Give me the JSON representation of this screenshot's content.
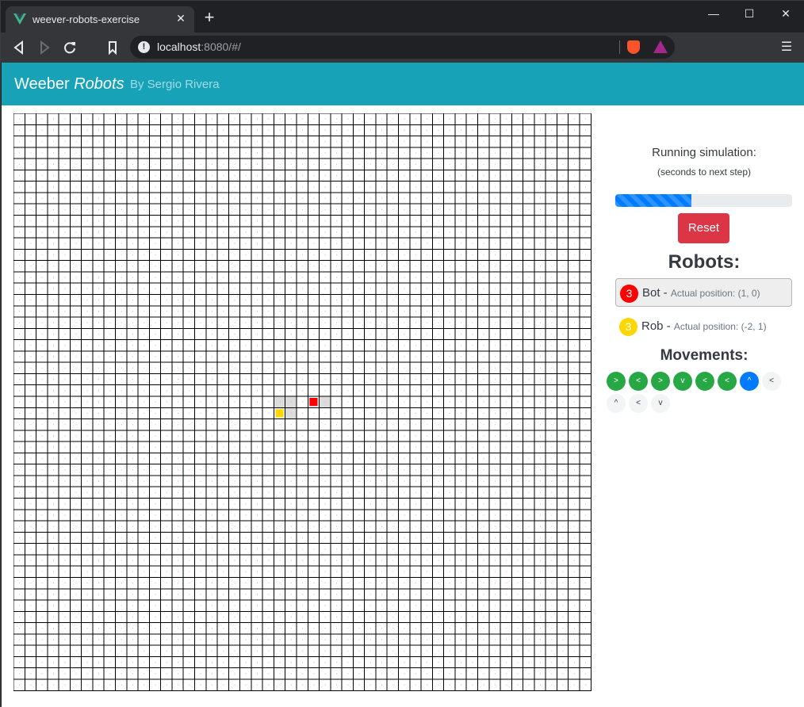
{
  "browser": {
    "tab_title": "weever-robots-exercise",
    "new_tab": "+",
    "minimize": "—",
    "maximize": "☐",
    "close": "✕",
    "url_host": "localhost",
    "url_rest": ":8080/#/",
    "icons": [
      "vue-logo-icon",
      "back-icon",
      "forward-icon",
      "reload-icon",
      "bookmark-icon",
      "info-icon",
      "brave-shield-icon",
      "bat-icon",
      "menu-icon"
    ]
  },
  "header": {
    "brand_main": "Weeber",
    "brand_italic": "Robots",
    "author": "By Sergio Rivera",
    "color": "#17a2b8"
  },
  "grid": {
    "cols": 51,
    "rows": 51,
    "robots_on_grid": [
      {
        "name": "Bot",
        "col": 26,
        "row": 25,
        "color": "#ff0000"
      },
      {
        "name": "Rob",
        "col": 23,
        "row": 26,
        "color": "#ffd700"
      }
    ],
    "highlighted_cells": [
      {
        "col": 23,
        "row": 25
      },
      {
        "col": 24,
        "row": 25
      },
      {
        "col": 24,
        "row": 26
      },
      {
        "col": 27,
        "row": 25
      }
    ]
  },
  "simulation": {
    "title": "Running simulation:",
    "subtitle": "(seconds to next step)",
    "progress": 0.43,
    "reset_label": "Reset"
  },
  "robots": {
    "title": "Robots:",
    "list": [
      {
        "badge": "3",
        "name": "Bot -",
        "position": "Actual position: (1, 0)",
        "color": "#ff0000",
        "active": true
      },
      {
        "badge": "3",
        "name": "Rob -",
        "position": "Actual position: (-2, 1)",
        "color": "#ffd700",
        "active": false
      }
    ]
  },
  "movements": {
    "title": "Movements:",
    "list": [
      {
        "label": ">",
        "state": "done"
      },
      {
        "label": "<",
        "state": "done"
      },
      {
        "label": ">",
        "state": "done"
      },
      {
        "label": "v",
        "state": "done"
      },
      {
        "label": "<",
        "state": "done"
      },
      {
        "label": "<",
        "state": "done"
      },
      {
        "label": "^",
        "state": "current"
      },
      {
        "label": "<",
        "state": "pending"
      },
      {
        "label": "^",
        "state": "pending"
      },
      {
        "label": "<",
        "state": "pending"
      },
      {
        "label": "v",
        "state": "pending"
      }
    ]
  }
}
